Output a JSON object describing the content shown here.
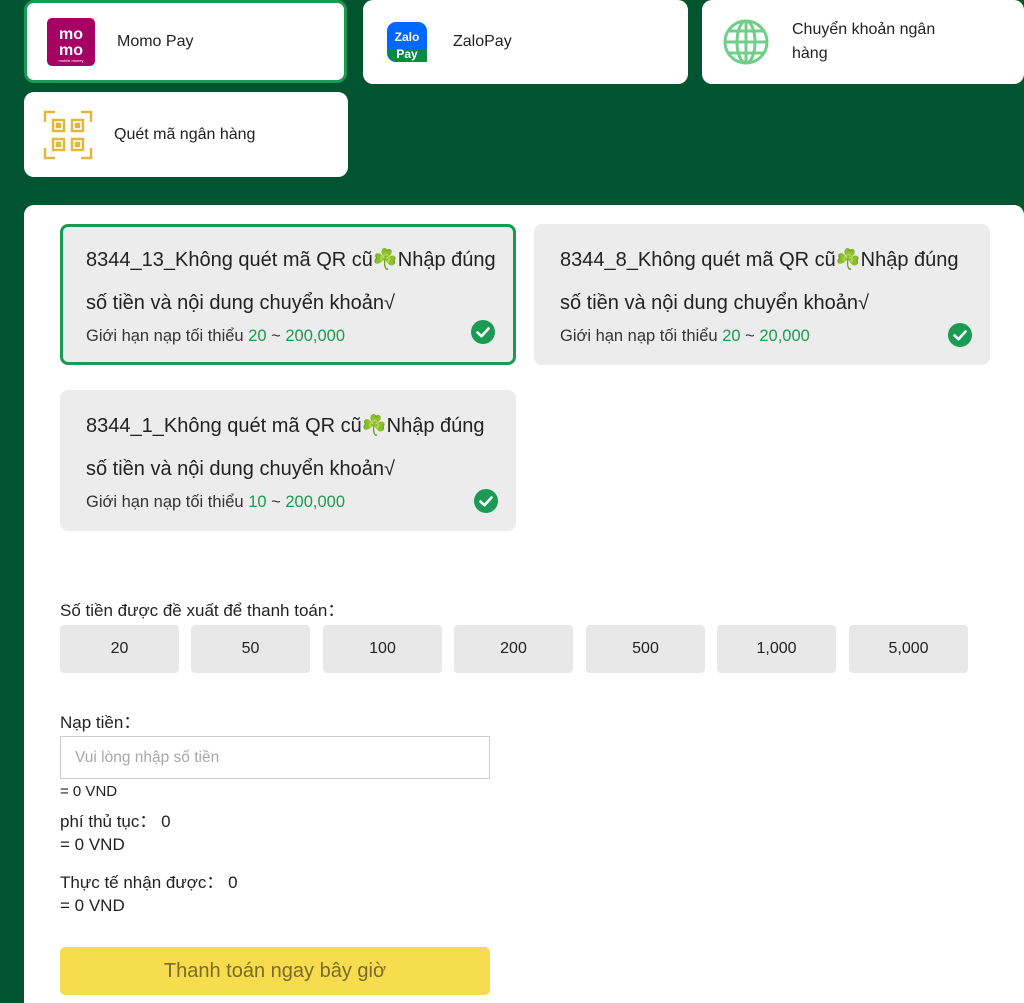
{
  "methods": [
    {
      "label": "Momo Pay",
      "icon": "momo-logo-icon"
    },
    {
      "label": "ZaloPay",
      "icon": "zalopay-logo-icon"
    },
    {
      "label": "Chuyển khoản ngân hàng",
      "icon": "globe-icon"
    },
    {
      "label": "Quét mã ngân hàng",
      "icon": "qr-code-icon"
    }
  ],
  "logos": {
    "momo_top": "mo",
    "momo_bottom": "mo",
    "momo_caption": "mobile money",
    "zalo_top": "Zalo",
    "zalo_bottom": "Pay"
  },
  "channels": [
    {
      "title": "8344_13_Không quét mã QR cũ☘️Nhập đúng số tiền và nội dung chuyển khoản√",
      "limit_label": "Giới hạn nạp tối thiểu",
      "min": "20",
      "sep": "~",
      "max": "200,000"
    },
    {
      "title": "8344_8_Không quét mã QR cũ☘️Nhập đúng số tiền và nội dung chuyển khoản√",
      "limit_label": "Giới hạn nạp tối thiểu",
      "min": "20",
      "sep": "~",
      "max": "20,000"
    },
    {
      "title": "8344_1_Không quét mã QR cũ☘️Nhập đúng số tiền và nội dung chuyển khoản√",
      "limit_label": "Giới hạn nạp tối thiểu",
      "min": "10",
      "sep": "~",
      "max": "200,000"
    }
  ],
  "suggested": {
    "label": "Số tiền được đề xuất để thanh toán：",
    "amounts": [
      "20",
      "50",
      "100",
      "200",
      "500",
      "1,000",
      "5,000"
    ]
  },
  "deposit": {
    "label": "Nạp tiền：",
    "placeholder": "Vui lòng nhập số tiền",
    "value": "",
    "converted": "= 0 VND"
  },
  "fee": {
    "label": "phí thủ tục：",
    "value": "0",
    "converted": "= 0 VND"
  },
  "received": {
    "label": "Thực tế nhận được：",
    "value": "0",
    "converted": "= 0 VND"
  },
  "submit_label": "Thanh toán ngay bây giờ",
  "colors": {
    "background": "#005530",
    "accent": "#1a9a52",
    "pay_button": "#f7dd4e",
    "momo": "#a50064",
    "zalo": "#0068ff"
  }
}
